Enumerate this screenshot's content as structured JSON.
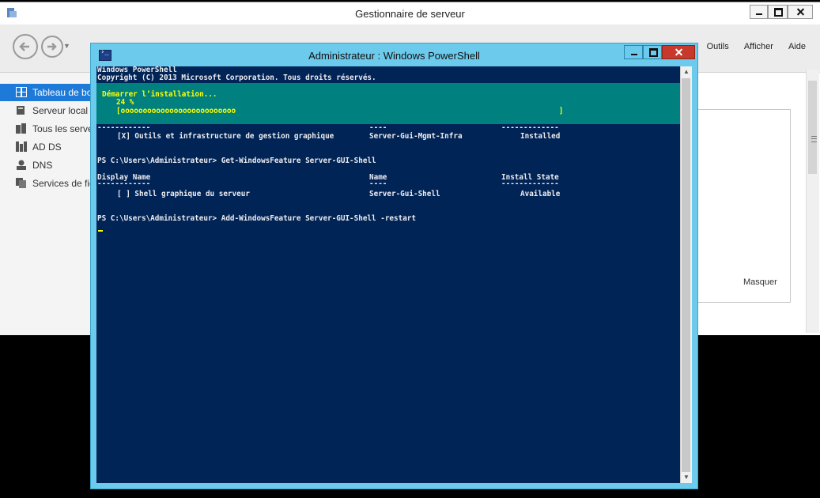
{
  "server_manager": {
    "title": "Gestionnaire de serveur",
    "menu": [
      "Outils",
      "Afficher",
      "Aide"
    ],
    "sidebar": [
      {
        "label": "Tableau de bord",
        "icon": "dashboard-icon",
        "active": true
      },
      {
        "label": "Serveur local",
        "icon": "server-icon",
        "active": false
      },
      {
        "label": "Tous les serveurs",
        "icon": "servers-icon",
        "active": false
      },
      {
        "label": "AD DS",
        "icon": "ad-ds-icon",
        "active": false
      },
      {
        "label": "DNS",
        "icon": "dns-icon",
        "active": false
      },
      {
        "label": "Services de fichiers",
        "icon": "file-services-icon",
        "active": false
      }
    ],
    "hide_link": "Masquer"
  },
  "powershell": {
    "title": "Administrateur : Windows PowerShell",
    "banner": [
      "Windows PowerShell",
      "Copyright (C) 2013 Microsoft Corporation. Tous droits réservés."
    ],
    "progress": {
      "activity": "Démarrer l’installation...",
      "percent_text": "24 %",
      "bar": "[oooooooooooooooooooooooooo                                                                         ]"
    },
    "table1": {
      "separator": [
        "------------",
        "----",
        "-------------"
      ],
      "row": {
        "display": "[X] Outils et infrastructure de gestion graphique",
        "name": "Server-Gui-Mgmt-Infra",
        "state": "Installed"
      }
    },
    "command1": "PS C:\\Users\\Administrateur> Get-WindowsFeature Server-GUI-Shell",
    "table2": {
      "headers": {
        "display": "Display Name",
        "name": "Name",
        "state": "Install State"
      },
      "separator": [
        "------------",
        "----",
        "-------------"
      ],
      "row": {
        "display": "[ ] Shell graphique du serveur",
        "name": "Server-Gui-Shell",
        "state": "Available"
      }
    },
    "command2": "PS C:\\Users\\Administrateur> Add-WindowsFeature Server-GUI-Shell -restart"
  }
}
